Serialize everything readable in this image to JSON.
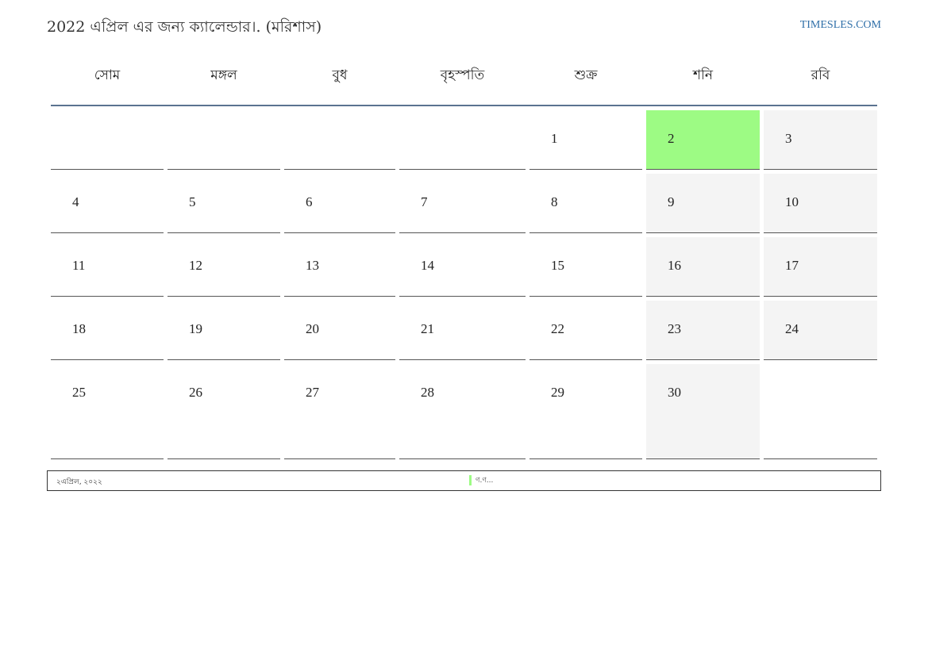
{
  "header": {
    "title": "2022 এপ্রিল এর জন্য ক্যালেন্ডার।. (মরিশাস)",
    "site": "TIMESLES.COM"
  },
  "weekdays": [
    "সোম",
    "মঙ্গল",
    "বুধ",
    "বৃহস্পতি",
    "শুক্র",
    "শনি",
    "রবি"
  ],
  "weeks": [
    [
      "",
      "",
      "",
      "",
      "1",
      "2",
      "3"
    ],
    [
      "4",
      "5",
      "6",
      "7",
      "8",
      "9",
      "10"
    ],
    [
      "11",
      "12",
      "13",
      "14",
      "15",
      "16",
      "17"
    ],
    [
      "18",
      "19",
      "20",
      "21",
      "22",
      "23",
      "24"
    ],
    [
      "25",
      "26",
      "27",
      "28",
      "29",
      "30",
      ""
    ]
  ],
  "colors": {
    "holiday": "#9dfb84",
    "weekend": "#f4f4f4",
    "header_rule": "#5a7390",
    "site_link": "#2f6fa8"
  },
  "legend": {
    "date": "২এপ্রিল, ২০২২",
    "holiday_name": "ণ.ণ..."
  }
}
